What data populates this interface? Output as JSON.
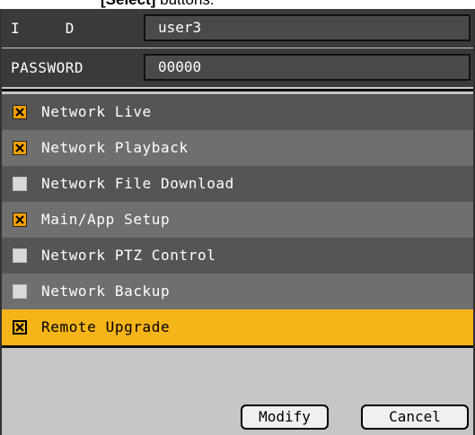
{
  "caption": {
    "bold_text": "[Select]",
    "rest_text": " buttons."
  },
  "credentials": {
    "id_label": "I     D",
    "id_value": "user3",
    "password_label": "PASSWORD",
    "password_value": "00000"
  },
  "permissions": [
    {
      "label": "Network Live",
      "checked": true
    },
    {
      "label": "Network Playback",
      "checked": true
    },
    {
      "label": "Network File Download",
      "checked": false
    },
    {
      "label": "Main/App Setup",
      "checked": true
    },
    {
      "label": "Network PTZ Control",
      "checked": false
    },
    {
      "label": "Network Backup",
      "checked": false
    },
    {
      "label": "Remote Upgrade",
      "checked": true,
      "highlighted": true
    }
  ],
  "buttons": {
    "modify": "Modify",
    "cancel": "Cancel"
  },
  "colors": {
    "highlight": "#f5b418",
    "checkbox_checked": "#f5a100",
    "panel_bg": "#c6c6c6"
  }
}
